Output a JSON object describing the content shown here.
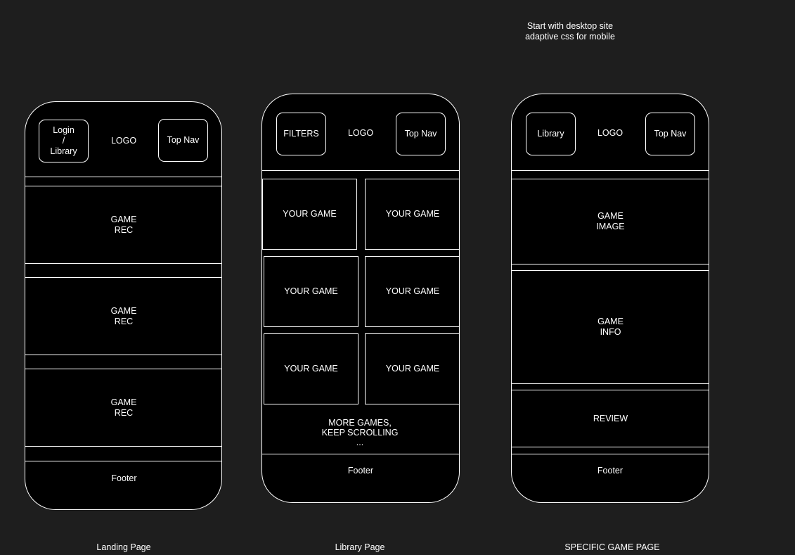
{
  "note": "Start with desktop site\nadaptive css for mobile",
  "landing": {
    "caption": "Landing Page",
    "header": {
      "left_button": "Login\n/\nLibrary",
      "logo": "LOGO",
      "right_button": "Top Nav"
    },
    "blocks": [
      "GAME\nREC",
      "GAME\nREC",
      "GAME\nREC"
    ],
    "footer": "Footer"
  },
  "library": {
    "caption": "Library Page",
    "header": {
      "left_button": "FILTERS",
      "logo": "LOGO",
      "right_button": "Top Nav"
    },
    "tiles": [
      "YOUR GAME",
      "YOUR GAME",
      "YOUR GAME",
      "YOUR GAME",
      "YOUR GAME",
      "YOUR GAME"
    ],
    "more": "MORE GAMES,\nKEEP SCROLLING\n...",
    "footer": "Footer"
  },
  "game": {
    "caption": "SPECIFIC GAME PAGE",
    "header": {
      "left_button": "Library",
      "logo": "LOGO",
      "right_button": "Top Nav"
    },
    "image": "GAME\nIMAGE",
    "info": "GAME\nINFO",
    "review": "REVIEW",
    "footer": "Footer"
  }
}
